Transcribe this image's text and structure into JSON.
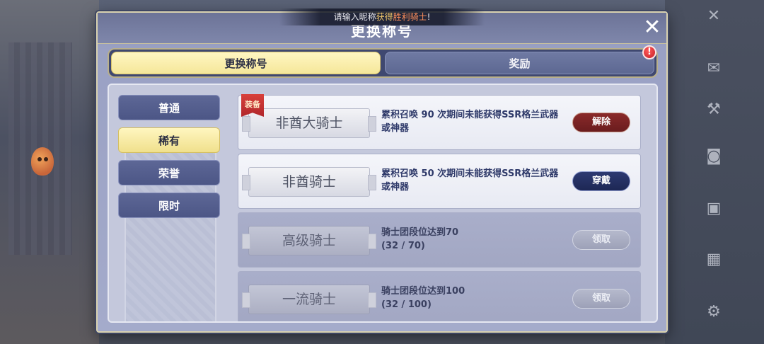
{
  "notice": {
    "prefix": "请输入昵称",
    "get": "获得",
    "title_name": "胜利骑士",
    "suffix": "!"
  },
  "dialog": {
    "title": "更换称号",
    "close_icon": "close-icon"
  },
  "tabs": [
    {
      "label": "更换称号",
      "active": true
    },
    {
      "label": "奖励",
      "active": false
    }
  ],
  "alert_badge": "!",
  "categories": [
    {
      "label": "普通",
      "selected": false
    },
    {
      "label": "稀有",
      "selected": true
    },
    {
      "label": "荣誉",
      "selected": false
    },
    {
      "label": "限时",
      "selected": false
    }
  ],
  "titles": [
    {
      "name": "非酋大骑士",
      "tag": "装备",
      "desc_line1": "累积召唤 90 次期间未能获得SSR格兰武器",
      "desc_line2": "或神器",
      "button": "解除",
      "state": "equipped"
    },
    {
      "name": "非酋骑士",
      "tag": "",
      "desc_line1": "累积召唤 50 次期间未能获得SSR格兰武器",
      "desc_line2": "或神器",
      "button": "穿戴",
      "state": "owned"
    },
    {
      "name": "高级骑士",
      "tag": "",
      "desc_line1": "骑士团段位达到70",
      "desc_line2": "(32 / 70)",
      "button": "领取",
      "state": "locked"
    },
    {
      "name": "一流骑士",
      "tag": "",
      "desc_line1": "骑士团段位达到100",
      "desc_line2": "(32 / 100)",
      "button": "领取",
      "state": "locked"
    }
  ],
  "side_icons": [
    "close-icon",
    "mail-icon",
    "tools-icon",
    "camera-icon",
    "video-icon",
    "calendar-icon",
    "settings-icon"
  ]
}
